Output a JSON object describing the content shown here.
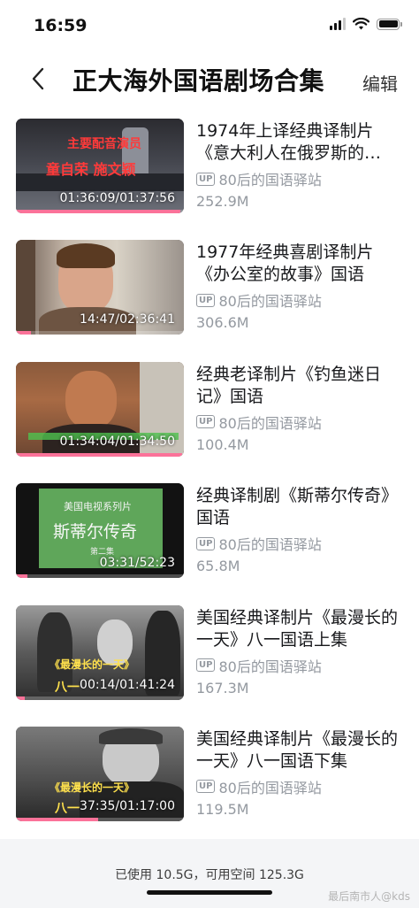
{
  "status_bar": {
    "time": "16:59"
  },
  "nav": {
    "title": "正大海外国语剧场合集",
    "edit_label": "编辑"
  },
  "up_badge": "UP",
  "videos": [
    {
      "title": "1974年上译经典译制片《意大利人在俄罗斯的…",
      "uploader": "80后的国语驿站",
      "size": "252.9M",
      "duration": "01:36:09/01:37:56",
      "progress": 0.98,
      "overlay_lines": [
        "主要配音演员",
        "童自荣 施文颖"
      ]
    },
    {
      "title": "1977年经典喜剧译制片《办公室的故事》国语",
      "uploader": "80后的国语驿站",
      "size": "306.6M",
      "duration": "14:47/02:36:41",
      "progress": 0.09
    },
    {
      "title": "经典老译制片《钓鱼迷日记》国语",
      "uploader": "80后的国语驿站",
      "size": "100.4M",
      "duration": "01:34:04/01:34:50",
      "progress": 0.99
    },
    {
      "title": "经典译制剧《斯蒂尔传奇》国语",
      "uploader": "80后的国语驿站",
      "size": "65.8M",
      "duration": "03:31/52:23",
      "progress": 0.07,
      "overlay_lines": [
        "美国电视系列片",
        "斯蒂尔传奇",
        "第二集"
      ]
    },
    {
      "title": "美国经典译制片《最漫长的一天》八一国语上集",
      "uploader": "80后的国语驿站",
      "size": "167.3M",
      "duration": "00:14/01:41:24",
      "progress": 0.05,
      "overlay_lines": [
        "《最漫长的一天》",
        "八一"
      ]
    },
    {
      "title": "美国经典译制片《最漫长的一天》八一国语下集",
      "uploader": "80后的国语驿站",
      "size": "119.5M",
      "duration": "37:35/01:17:00",
      "progress": 0.49,
      "overlay_lines": [
        "《最漫长的一天》",
        "八一"
      ]
    }
  ],
  "storage": {
    "text": "已使用 10.5G，可用空间 125.3G"
  },
  "watermark": "最后南市人@kds",
  "colors": {
    "accent": "#fb7299",
    "secondary_text": "#9499a0",
    "footer_bg": "#f4f5f7"
  }
}
